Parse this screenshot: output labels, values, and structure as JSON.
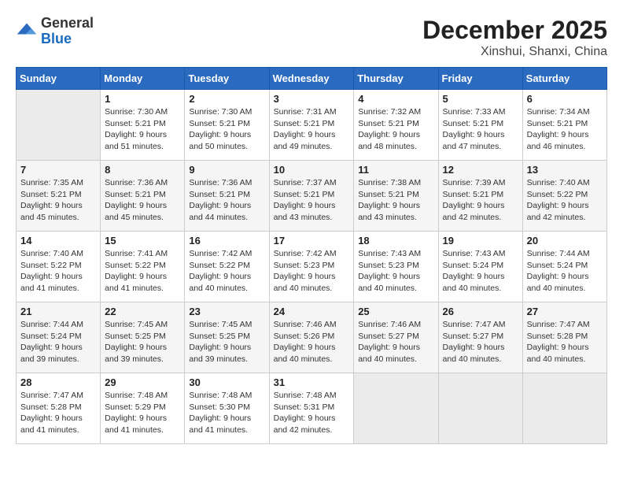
{
  "header": {
    "logo": {
      "general": "General",
      "blue": "Blue"
    },
    "month": "December 2025",
    "location": "Xinshui, Shanxi, China"
  },
  "days_of_week": [
    "Sunday",
    "Monday",
    "Tuesday",
    "Wednesday",
    "Thursday",
    "Friday",
    "Saturday"
  ],
  "weeks": [
    [
      {
        "day": "",
        "empty": true
      },
      {
        "day": "1",
        "sunrise": "Sunrise: 7:30 AM",
        "sunset": "Sunset: 5:21 PM",
        "daylight": "Daylight: 9 hours and 51 minutes."
      },
      {
        "day": "2",
        "sunrise": "Sunrise: 7:30 AM",
        "sunset": "Sunset: 5:21 PM",
        "daylight": "Daylight: 9 hours and 50 minutes."
      },
      {
        "day": "3",
        "sunrise": "Sunrise: 7:31 AM",
        "sunset": "Sunset: 5:21 PM",
        "daylight": "Daylight: 9 hours and 49 minutes."
      },
      {
        "day": "4",
        "sunrise": "Sunrise: 7:32 AM",
        "sunset": "Sunset: 5:21 PM",
        "daylight": "Daylight: 9 hours and 48 minutes."
      },
      {
        "day": "5",
        "sunrise": "Sunrise: 7:33 AM",
        "sunset": "Sunset: 5:21 PM",
        "daylight": "Daylight: 9 hours and 47 minutes."
      },
      {
        "day": "6",
        "sunrise": "Sunrise: 7:34 AM",
        "sunset": "Sunset: 5:21 PM",
        "daylight": "Daylight: 9 hours and 46 minutes."
      }
    ],
    [
      {
        "day": "7",
        "sunrise": "Sunrise: 7:35 AM",
        "sunset": "Sunset: 5:21 PM",
        "daylight": "Daylight: 9 hours and 45 minutes."
      },
      {
        "day": "8",
        "sunrise": "Sunrise: 7:36 AM",
        "sunset": "Sunset: 5:21 PM",
        "daylight": "Daylight: 9 hours and 45 minutes."
      },
      {
        "day": "9",
        "sunrise": "Sunrise: 7:36 AM",
        "sunset": "Sunset: 5:21 PM",
        "daylight": "Daylight: 9 hours and 44 minutes."
      },
      {
        "day": "10",
        "sunrise": "Sunrise: 7:37 AM",
        "sunset": "Sunset: 5:21 PM",
        "daylight": "Daylight: 9 hours and 43 minutes."
      },
      {
        "day": "11",
        "sunrise": "Sunrise: 7:38 AM",
        "sunset": "Sunset: 5:21 PM",
        "daylight": "Daylight: 9 hours and 43 minutes."
      },
      {
        "day": "12",
        "sunrise": "Sunrise: 7:39 AM",
        "sunset": "Sunset: 5:21 PM",
        "daylight": "Daylight: 9 hours and 42 minutes."
      },
      {
        "day": "13",
        "sunrise": "Sunrise: 7:40 AM",
        "sunset": "Sunset: 5:22 PM",
        "daylight": "Daylight: 9 hours and 42 minutes."
      }
    ],
    [
      {
        "day": "14",
        "sunrise": "Sunrise: 7:40 AM",
        "sunset": "Sunset: 5:22 PM",
        "daylight": "Daylight: 9 hours and 41 minutes."
      },
      {
        "day": "15",
        "sunrise": "Sunrise: 7:41 AM",
        "sunset": "Sunset: 5:22 PM",
        "daylight": "Daylight: 9 hours and 41 minutes."
      },
      {
        "day": "16",
        "sunrise": "Sunrise: 7:42 AM",
        "sunset": "Sunset: 5:22 PM",
        "daylight": "Daylight: 9 hours and 40 minutes."
      },
      {
        "day": "17",
        "sunrise": "Sunrise: 7:42 AM",
        "sunset": "Sunset: 5:23 PM",
        "daylight": "Daylight: 9 hours and 40 minutes."
      },
      {
        "day": "18",
        "sunrise": "Sunrise: 7:43 AM",
        "sunset": "Sunset: 5:23 PM",
        "daylight": "Daylight: 9 hours and 40 minutes."
      },
      {
        "day": "19",
        "sunrise": "Sunrise: 7:43 AM",
        "sunset": "Sunset: 5:24 PM",
        "daylight": "Daylight: 9 hours and 40 minutes."
      },
      {
        "day": "20",
        "sunrise": "Sunrise: 7:44 AM",
        "sunset": "Sunset: 5:24 PM",
        "daylight": "Daylight: 9 hours and 40 minutes."
      }
    ],
    [
      {
        "day": "21",
        "sunrise": "Sunrise: 7:44 AM",
        "sunset": "Sunset: 5:24 PM",
        "daylight": "Daylight: 9 hours and 39 minutes."
      },
      {
        "day": "22",
        "sunrise": "Sunrise: 7:45 AM",
        "sunset": "Sunset: 5:25 PM",
        "daylight": "Daylight: 9 hours and 39 minutes."
      },
      {
        "day": "23",
        "sunrise": "Sunrise: 7:45 AM",
        "sunset": "Sunset: 5:25 PM",
        "daylight": "Daylight: 9 hours and 39 minutes."
      },
      {
        "day": "24",
        "sunrise": "Sunrise: 7:46 AM",
        "sunset": "Sunset: 5:26 PM",
        "daylight": "Daylight: 9 hours and 40 minutes."
      },
      {
        "day": "25",
        "sunrise": "Sunrise: 7:46 AM",
        "sunset": "Sunset: 5:27 PM",
        "daylight": "Daylight: 9 hours and 40 minutes."
      },
      {
        "day": "26",
        "sunrise": "Sunrise: 7:47 AM",
        "sunset": "Sunset: 5:27 PM",
        "daylight": "Daylight: 9 hours and 40 minutes."
      },
      {
        "day": "27",
        "sunrise": "Sunrise: 7:47 AM",
        "sunset": "Sunset: 5:28 PM",
        "daylight": "Daylight: 9 hours and 40 minutes."
      }
    ],
    [
      {
        "day": "28",
        "sunrise": "Sunrise: 7:47 AM",
        "sunset": "Sunset: 5:28 PM",
        "daylight": "Daylight: 9 hours and 41 minutes."
      },
      {
        "day": "29",
        "sunrise": "Sunrise: 7:48 AM",
        "sunset": "Sunset: 5:29 PM",
        "daylight": "Daylight: 9 hours and 41 minutes."
      },
      {
        "day": "30",
        "sunrise": "Sunrise: 7:48 AM",
        "sunset": "Sunset: 5:30 PM",
        "daylight": "Daylight: 9 hours and 41 minutes."
      },
      {
        "day": "31",
        "sunrise": "Sunrise: 7:48 AM",
        "sunset": "Sunset: 5:31 PM",
        "daylight": "Daylight: 9 hours and 42 minutes."
      },
      {
        "day": "",
        "empty": true
      },
      {
        "day": "",
        "empty": true
      },
      {
        "day": "",
        "empty": true
      }
    ]
  ]
}
